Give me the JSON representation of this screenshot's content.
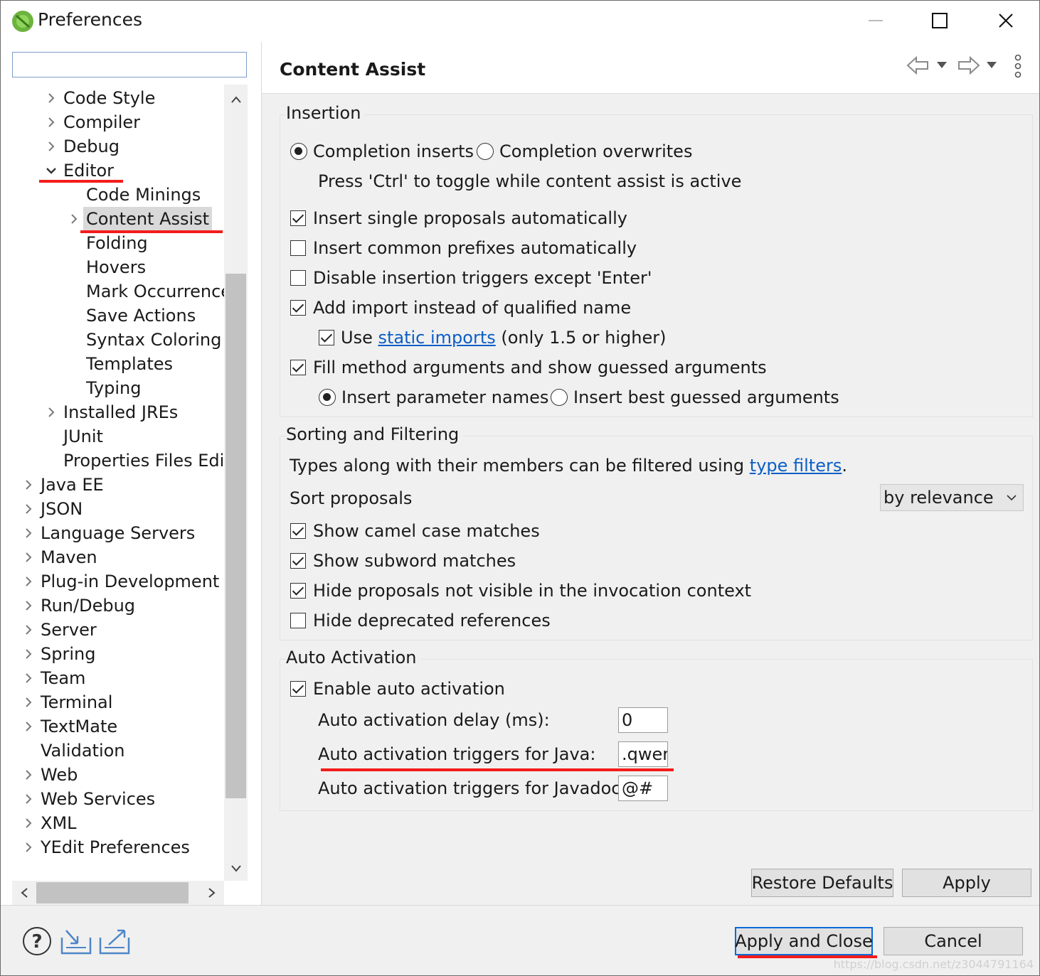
{
  "window": {
    "title": "Preferences",
    "minimize_icon": "minimize-icon",
    "maximize_icon": "maximize-icon",
    "close_icon": "close-icon"
  },
  "sidebar": {
    "filter_placeholder": "",
    "tree": [
      {
        "label": "Code Style",
        "indent": 1,
        "expander": "collapsed"
      },
      {
        "label": "Compiler",
        "indent": 1,
        "expander": "collapsed"
      },
      {
        "label": "Debug",
        "indent": 1,
        "expander": "collapsed"
      },
      {
        "label": "Editor",
        "indent": 1,
        "expander": "expanded"
      },
      {
        "label": "Code Minings",
        "indent": 2,
        "expander": "none"
      },
      {
        "label": "Content Assist",
        "indent": 2,
        "expander": "collapsed",
        "selected": true
      },
      {
        "label": "Folding",
        "indent": 2,
        "expander": "none"
      },
      {
        "label": "Hovers",
        "indent": 2,
        "expander": "none"
      },
      {
        "label": "Mark Occurrences",
        "indent": 2,
        "expander": "none"
      },
      {
        "label": "Save Actions",
        "indent": 2,
        "expander": "none"
      },
      {
        "label": "Syntax Coloring",
        "indent": 2,
        "expander": "none"
      },
      {
        "label": "Templates",
        "indent": 2,
        "expander": "none"
      },
      {
        "label": "Typing",
        "indent": 2,
        "expander": "none"
      },
      {
        "label": "Installed JREs",
        "indent": 1,
        "expander": "collapsed"
      },
      {
        "label": "JUnit",
        "indent": 1,
        "expander": "none"
      },
      {
        "label": "Properties Files Editor",
        "indent": 1,
        "expander": "none"
      },
      {
        "label": "Java EE",
        "indent": 0,
        "expander": "collapsed"
      },
      {
        "label": "JSON",
        "indent": 0,
        "expander": "collapsed"
      },
      {
        "label": "Language Servers",
        "indent": 0,
        "expander": "collapsed"
      },
      {
        "label": "Maven",
        "indent": 0,
        "expander": "collapsed"
      },
      {
        "label": "Plug-in Development",
        "indent": 0,
        "expander": "collapsed"
      },
      {
        "label": "Run/Debug",
        "indent": 0,
        "expander": "collapsed"
      },
      {
        "label": "Server",
        "indent": 0,
        "expander": "collapsed"
      },
      {
        "label": "Spring",
        "indent": 0,
        "expander": "collapsed"
      },
      {
        "label": "Team",
        "indent": 0,
        "expander": "collapsed"
      },
      {
        "label": "Terminal",
        "indent": 0,
        "expander": "collapsed"
      },
      {
        "label": "TextMate",
        "indent": 0,
        "expander": "collapsed"
      },
      {
        "label": "Validation",
        "indent": 0,
        "expander": "none"
      },
      {
        "label": "Web",
        "indent": 0,
        "expander": "collapsed"
      },
      {
        "label": "Web Services",
        "indent": 0,
        "expander": "collapsed"
      },
      {
        "label": "XML",
        "indent": 0,
        "expander": "collapsed"
      },
      {
        "label": "YEdit Preferences",
        "indent": 0,
        "expander": "collapsed"
      }
    ]
  },
  "page": {
    "title": "Content Assist",
    "nav_icons": [
      "back-arrow-icon",
      "forward-arrow-icon",
      "view-menu-icon"
    ]
  },
  "insertion": {
    "title": "Insertion",
    "completion_inserts": "Completion inserts",
    "completion_overwrites": "Completion overwrites",
    "toggle_hint": "Press 'Ctrl' to toggle while content assist is active",
    "insert_single": "Insert single proposals automatically",
    "insert_prefixes": "Insert common prefixes automatically",
    "disable_triggers": "Disable insertion triggers except 'Enter'",
    "add_import": "Add import instead of qualified name",
    "use_static_pre": "Use ",
    "use_static_link": "static imports",
    "use_static_post": " (only 1.5 or higher)",
    "fill_args": "Fill method arguments and show guessed arguments",
    "insert_param_names": "Insert parameter names",
    "insert_best_guessed": "Insert best guessed arguments"
  },
  "sorting": {
    "title": "Sorting and Filtering",
    "types_text_pre": "Types along with their members can be filtered using ",
    "types_link": "type filters",
    "types_text_post": ".",
    "sort_label": "Sort proposals",
    "sort_value": "by relevance",
    "show_camel": "Show camel case matches",
    "show_subword": "Show subword matches",
    "hide_not_visible": "Hide proposals not visible in the invocation context",
    "hide_deprecated": "Hide deprecated references"
  },
  "auto_activation": {
    "title": "Auto Activation",
    "enable": "Enable auto activation",
    "delay_label": "Auto activation delay (ms):",
    "delay_value": "0",
    "java_label": "Auto activation triggers for Java:",
    "java_value": ".qwer",
    "javadoc_label": "Auto activation triggers for Javadoc:",
    "javadoc_value": "@#"
  },
  "buttons": {
    "restore_defaults": "Restore Defaults",
    "apply": "Apply",
    "apply_and_close": "Apply and Close",
    "cancel": "Cancel"
  },
  "bottom_icons": [
    "help-icon",
    "import-icon",
    "export-icon"
  ],
  "watermark": "https://blog.csdn.net/z3044791164",
  "colors": {
    "link": "#0c5ec7",
    "annotation": "#f41c1c",
    "default_button_border": "#0a6ad8"
  }
}
